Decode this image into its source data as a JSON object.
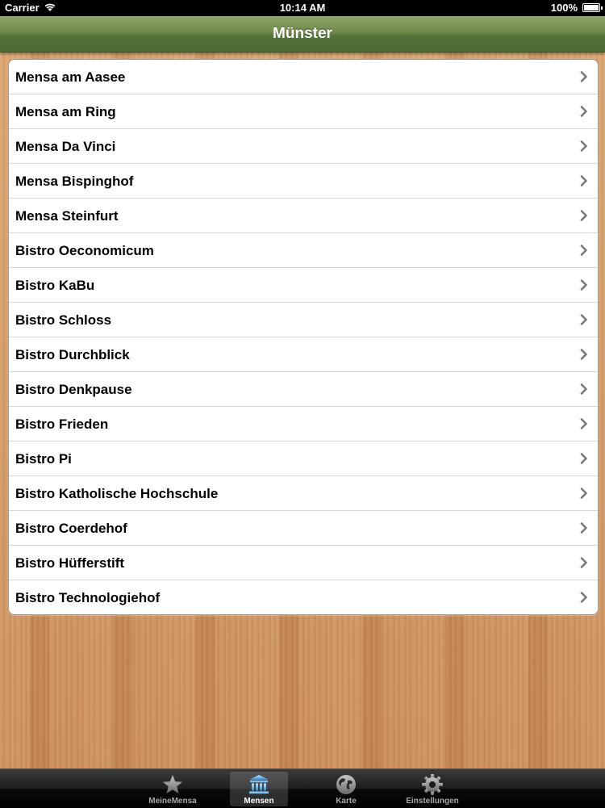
{
  "status": {
    "carrier": "Carrier",
    "time": "10:14 AM",
    "battery": "100%"
  },
  "nav": {
    "title": "Münster"
  },
  "list": {
    "items": [
      {
        "label": "Mensa am Aasee"
      },
      {
        "label": "Mensa am Ring"
      },
      {
        "label": "Mensa Da Vinci"
      },
      {
        "label": "Mensa Bispinghof"
      },
      {
        "label": "Mensa Steinfurt"
      },
      {
        "label": "Bistro Oeconomicum"
      },
      {
        "label": "Bistro KaBu"
      },
      {
        "label": "Bistro Schloss"
      },
      {
        "label": "Bistro Durchblick"
      },
      {
        "label": "Bistro Denkpause"
      },
      {
        "label": "Bistro Frieden"
      },
      {
        "label": "Bistro Pi"
      },
      {
        "label": "Bistro Katholische Hochschule"
      },
      {
        "label": "Bistro Coerdehof"
      },
      {
        "label": "Bistro Hüfferstift"
      },
      {
        "label": "Bistro Technologiehof"
      }
    ]
  },
  "tabs": [
    {
      "label": "MeineMensa",
      "icon": "star-icon",
      "selected": false
    },
    {
      "label": "Mensen",
      "icon": "building-icon",
      "selected": true
    },
    {
      "label": "Karte",
      "icon": "globe-icon",
      "selected": false
    },
    {
      "label": "Einstellungen",
      "icon": "gear-icon",
      "selected": false
    }
  ],
  "colors": {
    "navbar_green": "#5f7b41",
    "wood": "#cf9560",
    "selected_tab_blue": "#7ec8f2"
  }
}
